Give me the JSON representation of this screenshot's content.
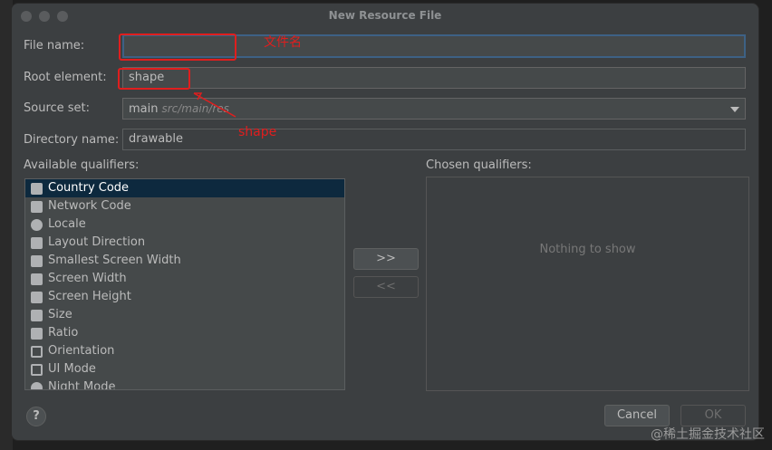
{
  "window": {
    "title": "New Resource File"
  },
  "form": {
    "file_name_label": "File name:",
    "file_name_value": "",
    "root_element_label": "Root element:",
    "root_element_value": "shape",
    "source_set_label": "Source set:",
    "source_set_value": "main",
    "source_set_hint": "src/main/res",
    "directory_name_label": "Directory name:",
    "directory_name_value": "drawable"
  },
  "annotations": {
    "file_name_note": "文件名",
    "root_element_note": "shape"
  },
  "qualifiers": {
    "available_label": "Available qualifiers:",
    "chosen_label": "Chosen qualifiers:",
    "items": [
      {
        "label": "Country Code",
        "icon": "flag-icon",
        "selected": true
      },
      {
        "label": "Network Code",
        "icon": "network-icon",
        "selected": false
      },
      {
        "label": "Locale",
        "icon": "globe-icon",
        "selected": false
      },
      {
        "label": "Layout Direction",
        "icon": "layout-direction-icon",
        "selected": false
      },
      {
        "label": "Smallest Screen Width",
        "icon": "smallest-width-icon",
        "selected": false
      },
      {
        "label": "Screen Width",
        "icon": "screen-width-icon",
        "selected": false
      },
      {
        "label": "Screen Height",
        "icon": "screen-height-icon",
        "selected": false
      },
      {
        "label": "Size",
        "icon": "size-icon",
        "selected": false
      },
      {
        "label": "Ratio",
        "icon": "ratio-icon",
        "selected": false
      },
      {
        "label": "Orientation",
        "icon": "orientation-icon",
        "selected": false
      },
      {
        "label": "UI Mode",
        "icon": "ui-mode-icon",
        "selected": false
      },
      {
        "label": "Night Mode",
        "icon": "night-mode-icon",
        "selected": false
      }
    ],
    "empty_text": "Nothing to show",
    "add_label": ">>",
    "remove_label": "<<"
  },
  "footer": {
    "help_label": "?",
    "cancel_label": "Cancel",
    "ok_label": "OK"
  },
  "watermark": "@稀土掘金技术社区",
  "colors": {
    "dialog_bg": "#3c3f41",
    "selection": "#0d293e",
    "annotation": "#e01e1e",
    "focus_border": "#3d6185"
  }
}
